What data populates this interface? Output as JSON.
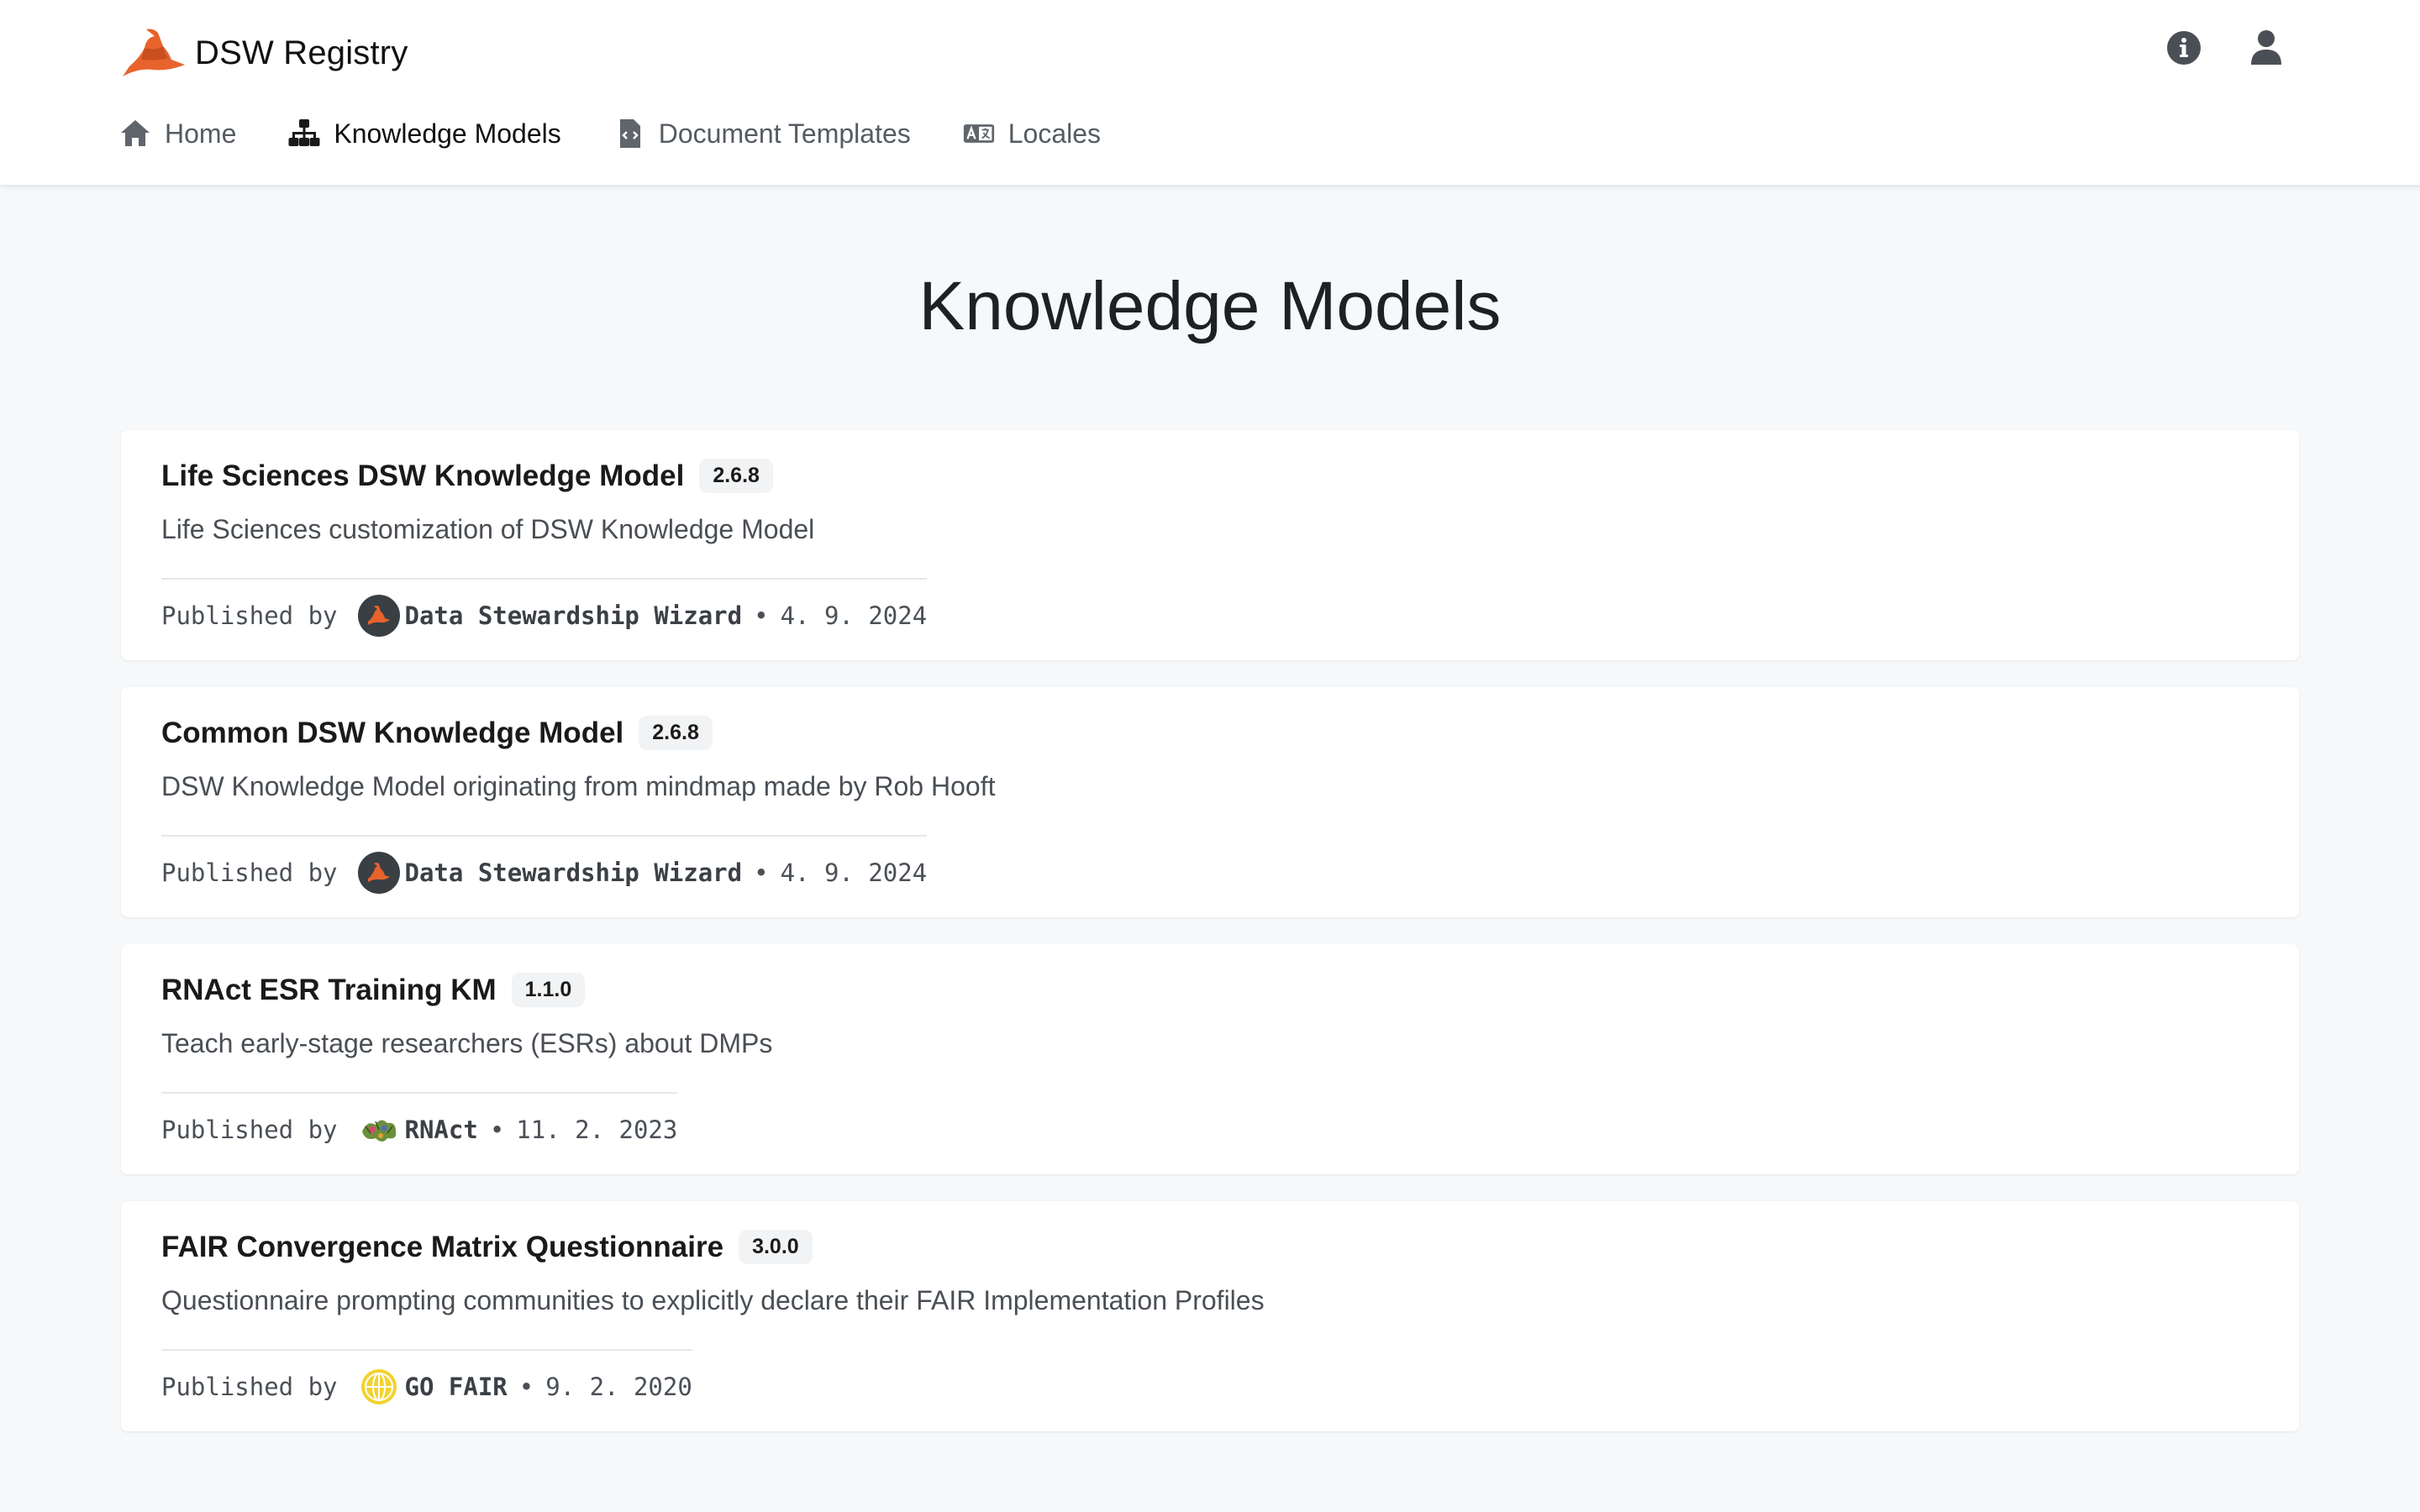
{
  "brand": {
    "name": "DSW Registry",
    "logo_icon": "wizard-hat-icon",
    "color": "#e8632c"
  },
  "top_actions": [
    {
      "icon": "info-icon"
    },
    {
      "icon": "user-icon"
    }
  ],
  "nav": {
    "items": [
      {
        "label": "Home",
        "icon": "home-icon",
        "active": false
      },
      {
        "label": "Knowledge Models",
        "icon": "sitemap-icon",
        "active": true
      },
      {
        "label": "Document Templates",
        "icon": "file-code-icon",
        "active": false
      },
      {
        "label": "Locales",
        "icon": "language-icon",
        "active": false
      }
    ]
  },
  "page": {
    "title": "Knowledge Models"
  },
  "published_by_label": "Published by",
  "knowledge_models": [
    {
      "title": "Life Sciences DSW Knowledge Model",
      "version": "2.6.8",
      "description": "Life Sciences customization of DSW Knowledge Model",
      "organization": "Data Stewardship Wizard",
      "org_icon": "dsw-logo-icon",
      "date": "4. 9. 2024"
    },
    {
      "title": "Common DSW Knowledge Model",
      "version": "2.6.8",
      "description": "DSW Knowledge Model originating from mindmap made by Rob Hooft",
      "organization": "Data Stewardship Wizard",
      "org_icon": "dsw-logo-icon",
      "date": "4. 9. 2024"
    },
    {
      "title": "RNAct ESR Training KM",
      "version": "1.1.0",
      "description": "Teach early-stage researchers (ESRs) about DMPs",
      "organization": "RNAct",
      "org_icon": "rnact-logo-icon",
      "date": "11. 2. 2023"
    },
    {
      "title": "FAIR Convergence Matrix Questionnaire",
      "version": "3.0.0",
      "description": "Questionnaire prompting communities to explicitly declare their FAIR Implementation Profiles",
      "organization": "GO FAIR",
      "org_icon": "gofair-logo-icon",
      "date": "9. 2. 2020"
    }
  ]
}
